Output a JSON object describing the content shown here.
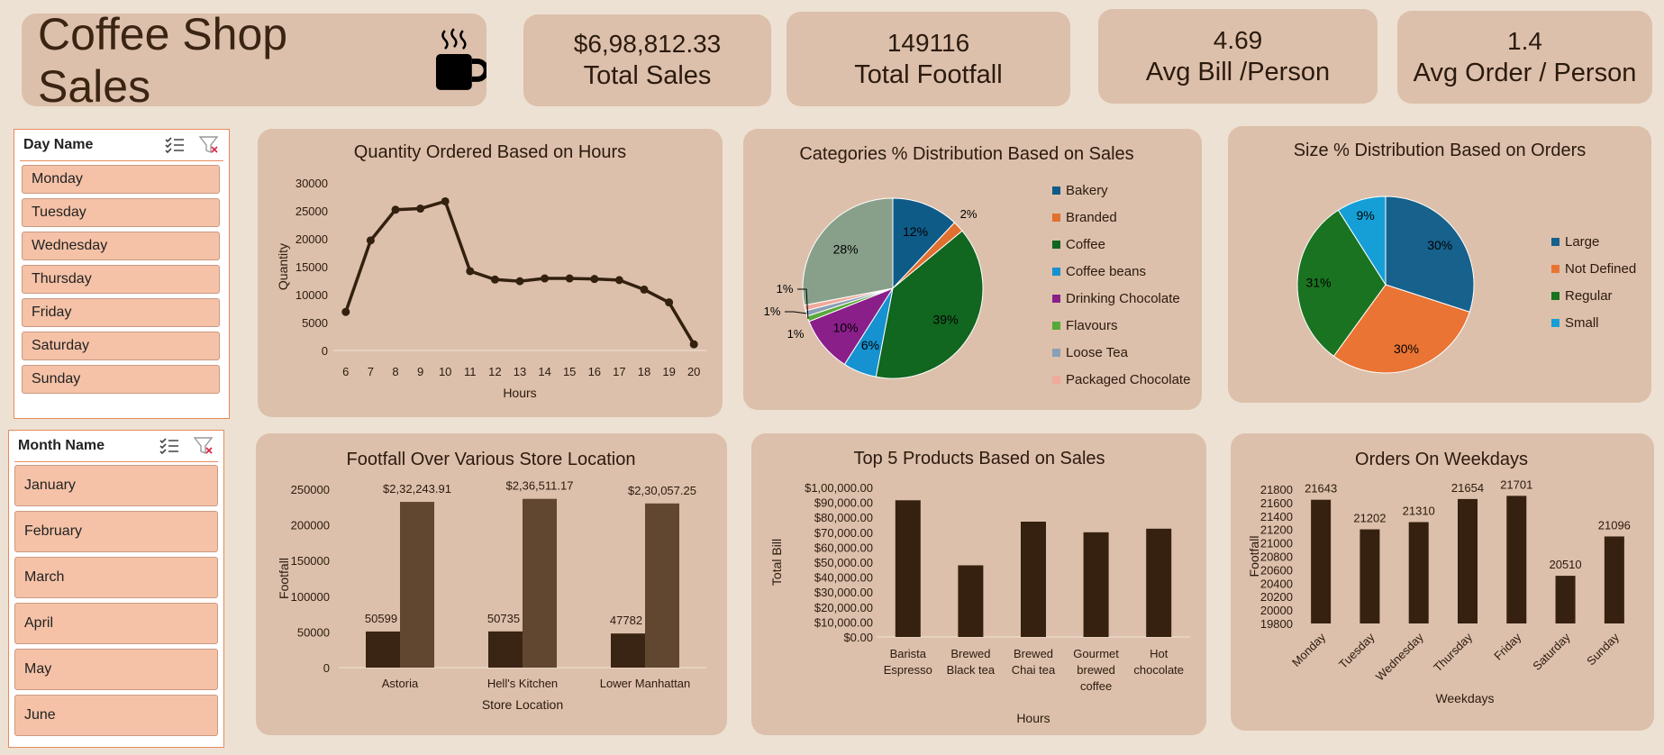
{
  "header": {
    "title": "Coffee Shop Sales",
    "icon": "coffee-mug-icon"
  },
  "kpis": [
    {
      "value": "$6,98,812.33",
      "label": "Total Sales"
    },
    {
      "value": "149116",
      "label": "Total Footfall"
    },
    {
      "value": "4.69",
      "label": "Avg Bill /Person"
    },
    {
      "value": "1.4",
      "label": "Avg Order / Person"
    }
  ],
  "slicers": {
    "day": {
      "title": "Day Name",
      "items": [
        "Monday",
        "Tuesday",
        "Wednesday",
        "Thursday",
        "Friday",
        "Saturday",
        "Sunday"
      ]
    },
    "month": {
      "title": "Month Name",
      "items": [
        "January",
        "February",
        "March",
        "April",
        "May",
        "June"
      ]
    }
  },
  "colors": {
    "background": "#ede1d3",
    "card": "#dcc0ab",
    "dark_brown": "#3a2413",
    "slicer_item": "#f5c2a7",
    "slicer_border": "#e88a5c"
  },
  "chart_data": [
    {
      "id": "hours",
      "type": "line",
      "title": "Quantity Ordered Based on Hours",
      "xlabel": "Hours",
      "ylabel": "Quantity",
      "x": [
        "6",
        "7",
        "8",
        "9",
        "10",
        "11",
        "12",
        "13",
        "14",
        "15",
        "16",
        "17",
        "18",
        "19",
        "20"
      ],
      "values": [
        6900,
        19700,
        25200,
        25400,
        26700,
        14200,
        12700,
        12400,
        12900,
        12900,
        12800,
        12600,
        10900,
        8600,
        1100
      ],
      "yticks": [
        0,
        5000,
        10000,
        15000,
        20000,
        25000,
        30000
      ],
      "ylim": [
        0,
        30000
      ],
      "color": "#33200f"
    },
    {
      "id": "categories",
      "type": "pie",
      "title": "Categories % Distribution Based on Sales",
      "slices": [
        {
          "name": "Bakery",
          "value": 12,
          "label": "12%",
          "color": "#0f5b87"
        },
        {
          "name": "Branded",
          "value": 2,
          "label": "2%",
          "color": "#e0702f"
        },
        {
          "name": "Coffee",
          "value": 39,
          "label": "39%",
          "color": "#116620"
        },
        {
          "name": "Coffee beans",
          "value": 6,
          "label": "6%",
          "color": "#1592cf"
        },
        {
          "name": "Drinking Chocolate",
          "value": 10,
          "label": "10%",
          "color": "#8a1f8a"
        },
        {
          "name": "Flavours",
          "value": 1,
          "label": "1%",
          "color": "#58a83a"
        },
        {
          "name": "Loose Tea",
          "value": 1,
          "label": "1%",
          "color": "#8a9fb5"
        },
        {
          "name": "Packaged Chocolate",
          "value": 1,
          "label": "1%",
          "color": "#f0a99a"
        },
        {
          "name": "",
          "value": 28,
          "label": "28%",
          "color": "#88a08a"
        }
      ]
    },
    {
      "id": "sizes",
      "type": "pie",
      "title": "Size  % Distribution Based on Orders",
      "slices": [
        {
          "name": "Large",
          "value": 30,
          "label": "30%",
          "color": "#17618d"
        },
        {
          "name": "Not Defined",
          "value": 30,
          "label": "30%",
          "color": "#ea7433"
        },
        {
          "name": "Regular",
          "value": 31,
          "label": "31%",
          "color": "#1a7321"
        },
        {
          "name": "Small",
          "value": 9,
          "label": "9%",
          "color": "#159fd6"
        }
      ]
    },
    {
      "id": "stores",
      "type": "bar",
      "title": "Footfall Over Various Store Location",
      "xlabel": "Store Location",
      "ylabel": "Footfall",
      "categories": [
        "Astoria",
        "Hell's Kitchen",
        "Lower Manhattan"
      ],
      "series": [
        {
          "values": [
            50599,
            50735,
            47782
          ],
          "labels": [
            "50599",
            "50735",
            "47782"
          ],
          "color": "#3a2413"
        },
        {
          "values": [
            232243.91,
            236511.17,
            230057.25
          ],
          "labels": [
            "$2,32,243.91",
            "$2,36,511.17",
            "$2,30,057.25"
          ],
          "color": "#614630"
        }
      ],
      "yticks": [
        0,
        50000,
        100000,
        150000,
        200000,
        250000
      ],
      "ylim": [
        0,
        250000
      ]
    },
    {
      "id": "products",
      "type": "bar",
      "title": "Top 5 Products Based on Sales",
      "xlabel": "Hours",
      "ylabel": "Total Bill",
      "categories": [
        [
          "Barista",
          "Espresso"
        ],
        [
          "Brewed",
          "Black tea"
        ],
        [
          "Brewed",
          "Chai tea"
        ],
        [
          "Gourmet",
          "brewed",
          "coffee"
        ],
        [
          "Hot",
          "chocolate"
        ]
      ],
      "values": [
        91400,
        47900,
        77100,
        70000,
        72400
      ],
      "yticks": [
        "$0.00",
        "$10,000.00",
        "$20,000.00",
        "$30,000.00",
        "$40,000.00",
        "$50,000.00",
        "$60,000.00",
        "$70,000.00",
        "$80,000.00",
        "$90,000.00",
        "$1,00,000.00"
      ],
      "ylim": [
        0,
        100000
      ],
      "color": "#36200f"
    },
    {
      "id": "weekdays",
      "type": "bar",
      "title": "Orders On Weekdays",
      "xlabel": "Weekdays",
      "ylabel": "Footfall",
      "categories": [
        "Monday",
        "Tuesday",
        "Wednesday",
        "Thursday",
        "Friday",
        "Saturday",
        "Sunday"
      ],
      "values": [
        21643,
        21202,
        21310,
        21654,
        21701,
        20510,
        21096
      ],
      "yticks": [
        19800,
        20000,
        20200,
        20400,
        20600,
        20800,
        21000,
        21200,
        21400,
        21600,
        21800
      ],
      "ylim": [
        19800,
        21800
      ],
      "color": "#36200f"
    }
  ]
}
